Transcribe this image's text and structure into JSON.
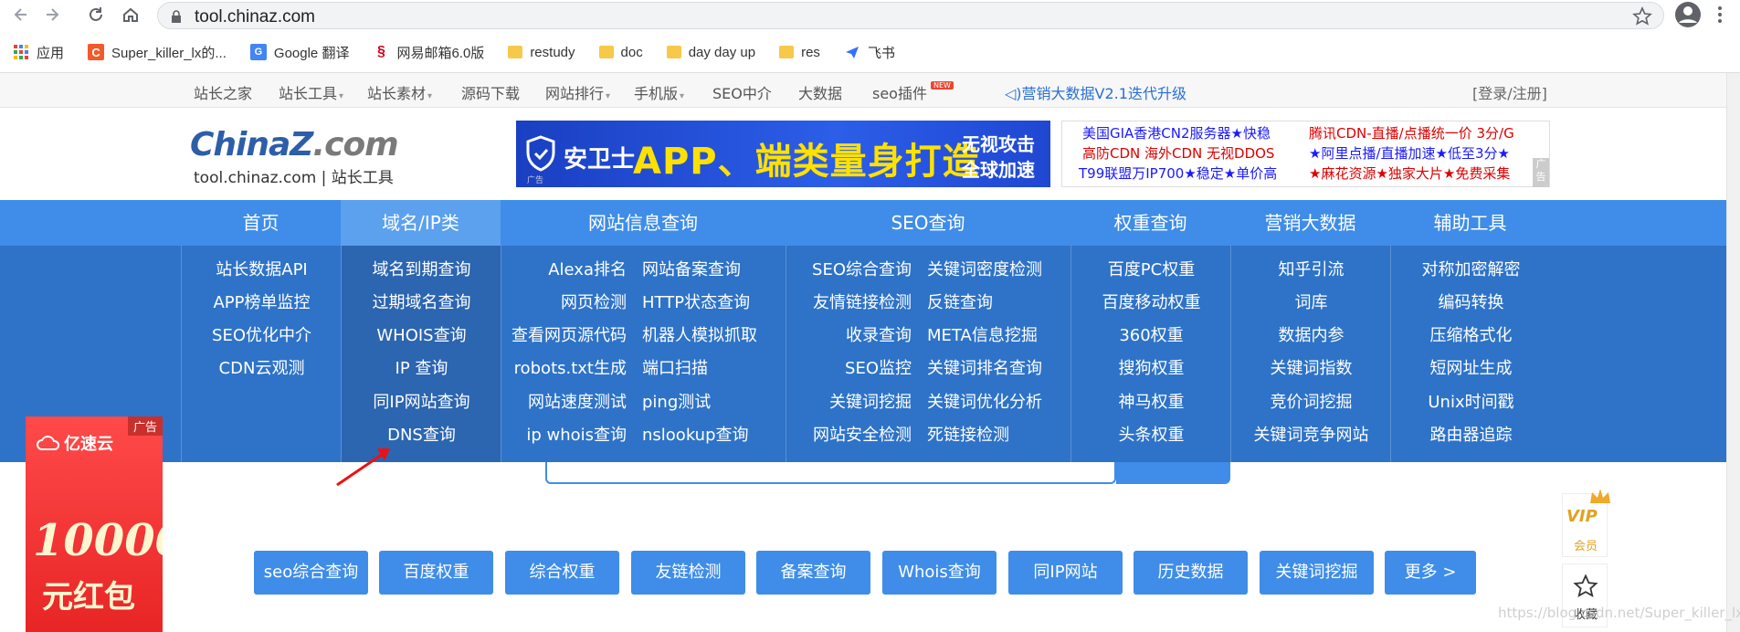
{
  "browser": {
    "url": "tool.chinaz.com",
    "bookmarks": [
      {
        "label": "应用",
        "icon": "apps-grid-icon"
      },
      {
        "label": "Super_killer_lx的...",
        "icon": "csdn-icon"
      },
      {
        "label": "Google 翻译",
        "icon": "google-translate-icon"
      },
      {
        "label": "网易邮箱6.0版",
        "icon": "netease-mail-icon"
      },
      {
        "label": "restudy",
        "icon": "folder-icon"
      },
      {
        "label": "doc",
        "icon": "folder-icon"
      },
      {
        "label": "day day up",
        "icon": "folder-icon"
      },
      {
        "label": "res",
        "icon": "folder-icon"
      },
      {
        "label": "飞书",
        "icon": "feishu-icon"
      }
    ]
  },
  "topbar": {
    "items": [
      "站长之家",
      "站长工具",
      "站长素材",
      "源码下载",
      "网站排行",
      "手机版",
      "SEO中介",
      "大数据",
      "seo插件"
    ],
    "new_badge": "NEW",
    "promo": "营销大数据V2.1迭代升级",
    "login": "[登录/注册]"
  },
  "header": {
    "logo_text": "ChinaZ",
    "logo_com": ".com",
    "logo_sub": "tool.chinaz.com | 站长工具",
    "banner": {
      "brand": "安卫士",
      "headline": "APP、端类量身打造",
      "side1": "无视攻击",
      "side2": "全球加速",
      "ad": "广告"
    },
    "text_ad": {
      "l1": "美国GIA香港CN2服务器★快稳",
      "l2": "高防CDN 海外CDN 无视DDOS",
      "l3": "T99联盟万IP700★稳定★单价高",
      "r1": "腾讯CDN-直播/点播统一价 3分/G",
      "r2": "★阿里点播/直播加速★低至3分★",
      "r3": "★麻花资源★独家大片★免费采集",
      "tag": "广告"
    }
  },
  "mainnav": {
    "tabs": [
      "首页",
      "域名/IP类",
      "网站信息查询",
      "SEO查询",
      "权重查询",
      "营销大数据",
      "辅助工具"
    ]
  },
  "dropdown": {
    "col_home": [
      "站长数据API",
      "APP榜单监控",
      "SEO优化中介",
      "CDN云观测"
    ],
    "col_domain": [
      "域名到期查询",
      "过期域名查询",
      "WHOIS查询",
      "IP 查询",
      "同IP网站查询",
      "DNS查询"
    ],
    "col_site_left": [
      "Alexa排名",
      "网页检测",
      "查看网页源代码",
      "robots.txt生成",
      "网站速度测试",
      "ip whois查询"
    ],
    "col_site_right": [
      "网站备案查询",
      "HTTP状态查询",
      "机器人模拟抓取",
      "端口扫描",
      "ping测试",
      "nslookup查询"
    ],
    "col_seo_left": [
      "SEO综合查询",
      "友情链接检测",
      "收录查询",
      "SEO监控",
      "关键词挖掘",
      "网站安全检测"
    ],
    "col_seo_right": [
      "关键词密度检测",
      "反链查询",
      "META信息挖掘",
      "关键词排名查询",
      "关键词优化分析",
      "死链接检测"
    ],
    "col_weight": [
      "百度PC权重",
      "百度移动权重",
      "360权重",
      "搜狗权重",
      "神马权重",
      "头条权重"
    ],
    "col_market": [
      "知乎引流",
      "词库",
      "数据内参",
      "关键词指数",
      "竞价词挖掘",
      "关键词竞争网站"
    ],
    "col_aux": [
      "对称加密解密",
      "编码转换",
      "压缩格式化",
      "短网址生成",
      "Unix时间戳",
      "路由器追踪"
    ]
  },
  "quick_buttons": [
    "seo综合查询",
    "百度权重",
    "综合权重",
    "友链检测",
    "备案查询",
    "Whois查询",
    "同IP网站",
    "历史数据",
    "关键词挖掘",
    "更多 >"
  ],
  "left_ad": {
    "label": "广告",
    "brand": "亿速云",
    "amount": "10000",
    "sub": "元红包"
  },
  "right_float": {
    "vip_text": "VIP",
    "vip_label": "会员",
    "fav_label": "收藏"
  },
  "watermark": "https://blog.csdn.net/Super_killer_lx",
  "colors": {
    "nav_blue": "#3f8de8",
    "dropdown_blue": "#2e73c8",
    "active_tab": "#5ba1ee"
  }
}
